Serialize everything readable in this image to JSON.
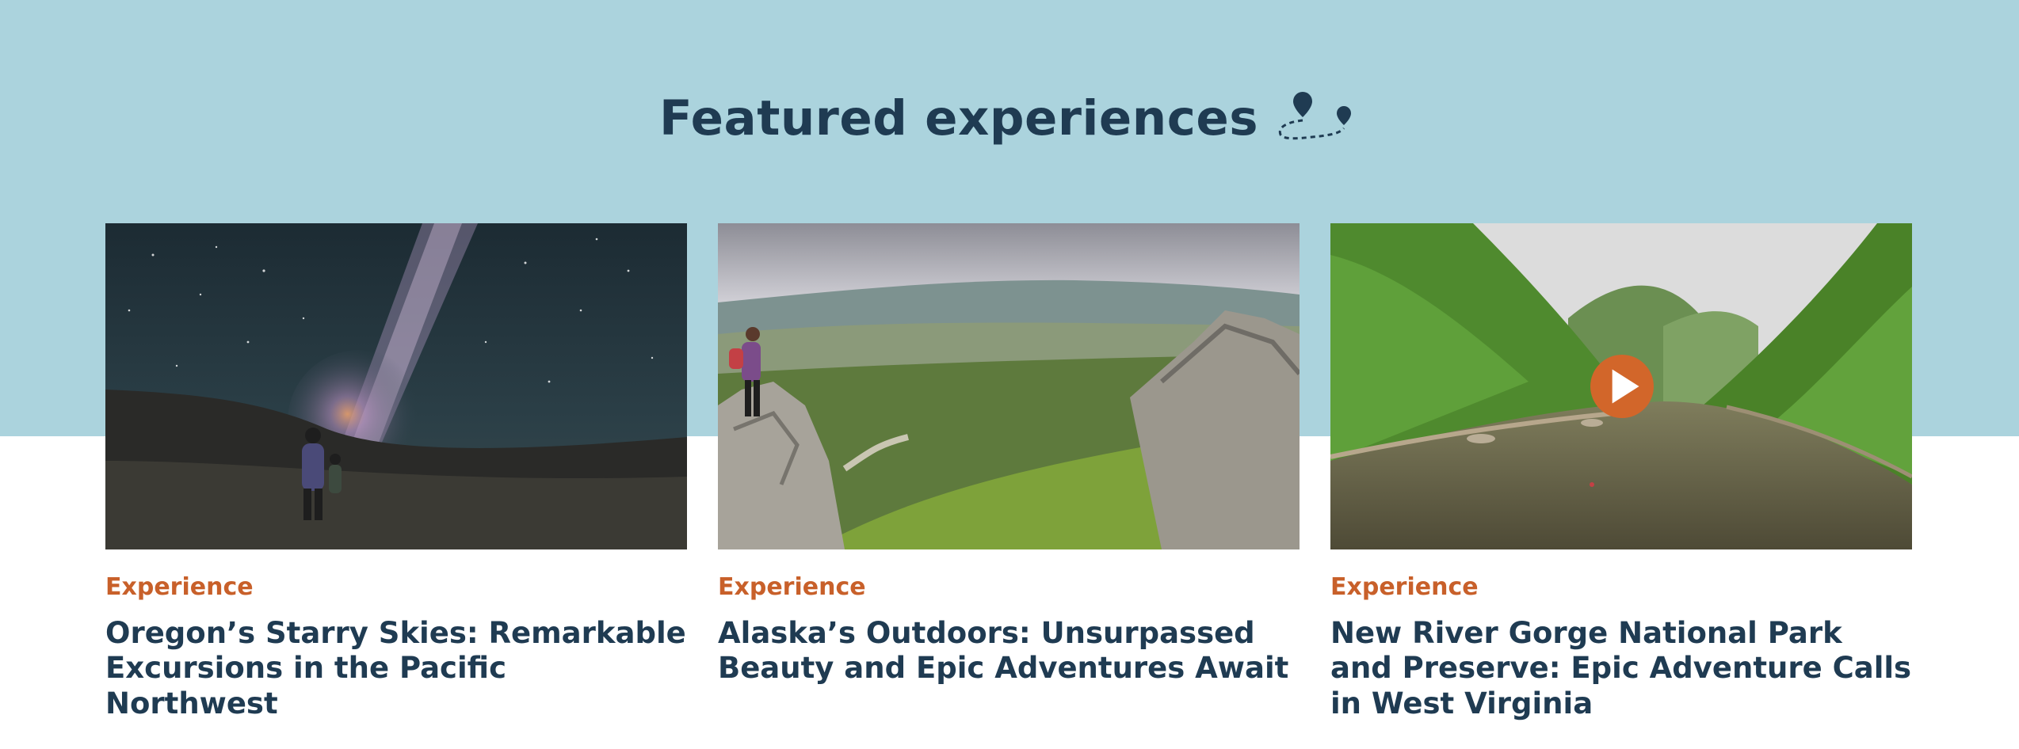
{
  "section": {
    "heading": "Featured experiences",
    "heading_icon": "map-route-pins-icon"
  },
  "cards": [
    {
      "tag": "Experience",
      "title": "Oregon’s Starry Skies: Remarkable Excursions in the Pacific Northwest",
      "image": "night-sky-milky-way-hikers-photo"
    },
    {
      "tag": "Experience",
      "title": "Alaska’s Outdoors: Unsurpassed Beauty and Epic Adventures Await",
      "image": "alaska-valley-hiker-on-rocks-photo"
    },
    {
      "tag": "Experience",
      "title": "New River Gorge National Park and Preserve: Epic Adventure Calls in West Virginia",
      "image": "river-gorge-forest-photo",
      "video_icon": "play-icon"
    }
  ],
  "colors": {
    "band": "#abd3dd",
    "heading": "#1f3b52",
    "tag": "#c8602a",
    "play_button": "#d2662a"
  }
}
